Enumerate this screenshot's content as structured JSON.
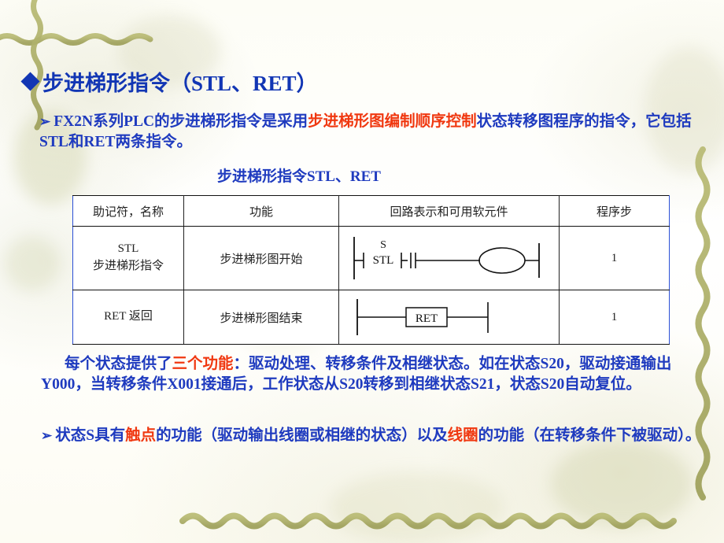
{
  "slide": {
    "title": "步进梯形指令（STL、RET）",
    "title_bullet": "diamond-bullet",
    "colors": {
      "heading_blue": "#1236b4",
      "body_blue": "#1f3bbf",
      "accent_red": "#f03810",
      "table_rail_blue": "#2a4fd6",
      "decor_olive": "#aeb06a"
    }
  },
  "intro": {
    "bullet": "➢",
    "seg1": "FX2N系列PLC的步进梯形指令是采用",
    "seg2_red": "步进梯形图编制顺序控制",
    "seg3": "状态转移图程序的指令，它包括STL和RET两条指令。"
  },
  "table_title": "步进梯形指令STL、RET",
  "table": {
    "headers": [
      "助记符，名称",
      "功能",
      "回路表示和可用软元件",
      "程序步"
    ],
    "rows": [
      {
        "mnemonic_line1": "STL",
        "mnemonic_line2": "步进梯形指令",
        "function": "步进梯形图开始",
        "diagram": "ladder-stl-contact-coil",
        "diagram_labels": {
          "top": "S",
          "bottom": "STL"
        },
        "steps": "1"
      },
      {
        "mnemonic_line1": "RET  返回",
        "mnemonic_line2": "",
        "function": "步进梯形图结束",
        "diagram": "ladder-ret-box",
        "diagram_labels": {
          "box": "RET"
        },
        "steps": "1"
      }
    ]
  },
  "para2": {
    "seg1": "每个状态提供了",
    "seg2_red": "三个功能",
    "seg3": "：驱动处理、转移条件及相继状态。如在状态S20，驱动接通输出Y000，当转移条件X001接通后，工作状态从S20转移到相继状态S21，状态S20自动复位。"
  },
  "para3": {
    "bullet": "➢",
    "seg1": "状态S具有",
    "seg2_red": "触点",
    "seg3": "的功能（驱动输出线圈或相继的状态）以及",
    "seg4_red": "线圈",
    "seg5": "的功能（在转移条件下被驱动）。"
  }
}
